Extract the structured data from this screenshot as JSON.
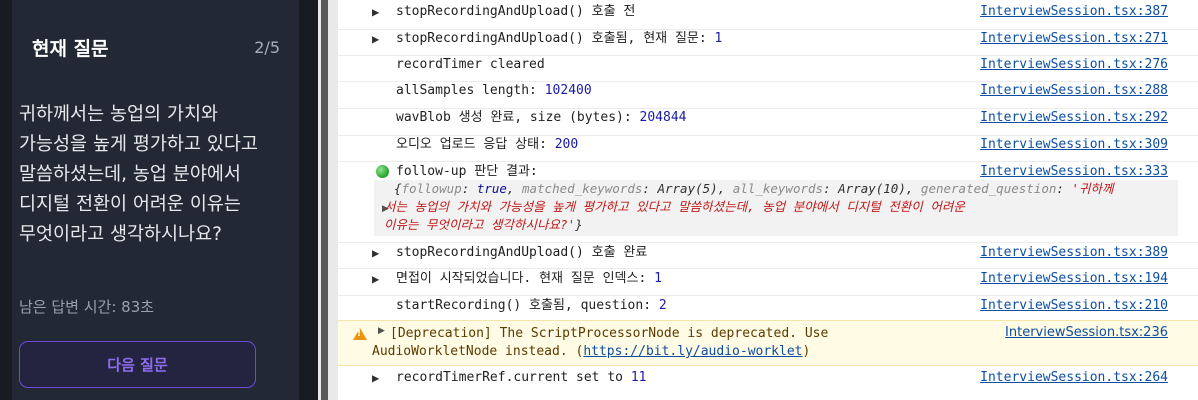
{
  "question_panel": {
    "title": "현재 질문",
    "counter": "2/5",
    "question_text": "귀하께서는 농업의 가치와 가능성을 높게 평가하고 있다고 말씀하셨는데, 농업 분야에서 디지털 전환이 어려운 이유는 무엇이라고 생각하시나요?",
    "time_left": "남은 답변 시간: 83초",
    "next_button": "다음 질문"
  },
  "console": {
    "rows": [
      {
        "text": "stopRecordingAndUpload() 호출 전",
        "source": "InterviewSession.tsx:387"
      },
      {
        "text": "stopRecordingAndUpload() 호출됨, 현재 질문: ",
        "num": "1",
        "source": "InterviewSession.tsx:271"
      },
      {
        "text": "recordTimer cleared",
        "source": "InterviewSession.tsx:276"
      },
      {
        "text": "allSamples length: ",
        "num": "102400",
        "source": "InterviewSession.tsx:288"
      },
      {
        "text": "wavBlob 생성 완료, size (bytes): ",
        "num": "204844",
        "source": "InterviewSession.tsx:292"
      },
      {
        "text": "오디오 업로드 응답 상태: ",
        "num": "200",
        "source": "InterviewSession.tsx:309"
      },
      {
        "text": "follow-up 판단 결과:",
        "source": "InterviewSession.tsx:333"
      },
      {
        "text": "stopRecordingAndUpload() 호출 완료",
        "source": "InterviewSession.tsx:389"
      },
      {
        "text": "면접이 시작되었습니다. 현재 질문 인덱스: ",
        "num": "1",
        "source": "InterviewSession.tsx:194"
      },
      {
        "text": "startRecording() 호출됨, question: ",
        "num": "2",
        "source": "InterviewSession.tsx:210"
      },
      {
        "text": "recordTimerRef.current set to ",
        "num": "11",
        "source": "InterviewSession.tsx:264"
      }
    ],
    "object": {
      "followup_key": "followup",
      "followup_val": "true",
      "matched_key": "matched_keywords",
      "matched_val": "Array(5)",
      "all_key": "all_keywords",
      "all_val": "Array(10)",
      "gen_key": "generated_question",
      "gen_val_line1": "'귀하께",
      "gen_val_line2": "서는 농업의 가치와 가능성을 높게 평가하고 있다고 말씀하셨는데, 농업 분야에서 디지털 전환이 어려운",
      "gen_val_line3": "이유는 무엇이라고 생각하시나요?'"
    },
    "warning": {
      "line1": "[Deprecation] The ScriptProcessorNode is deprecated. Use",
      "line2_prefix": "AudioWorkletNode instead. (",
      "link": "https://bit.ly/audio-worklet",
      "line2_suffix": ")",
      "source": "InterviewSession.tsx:236"
    }
  }
}
